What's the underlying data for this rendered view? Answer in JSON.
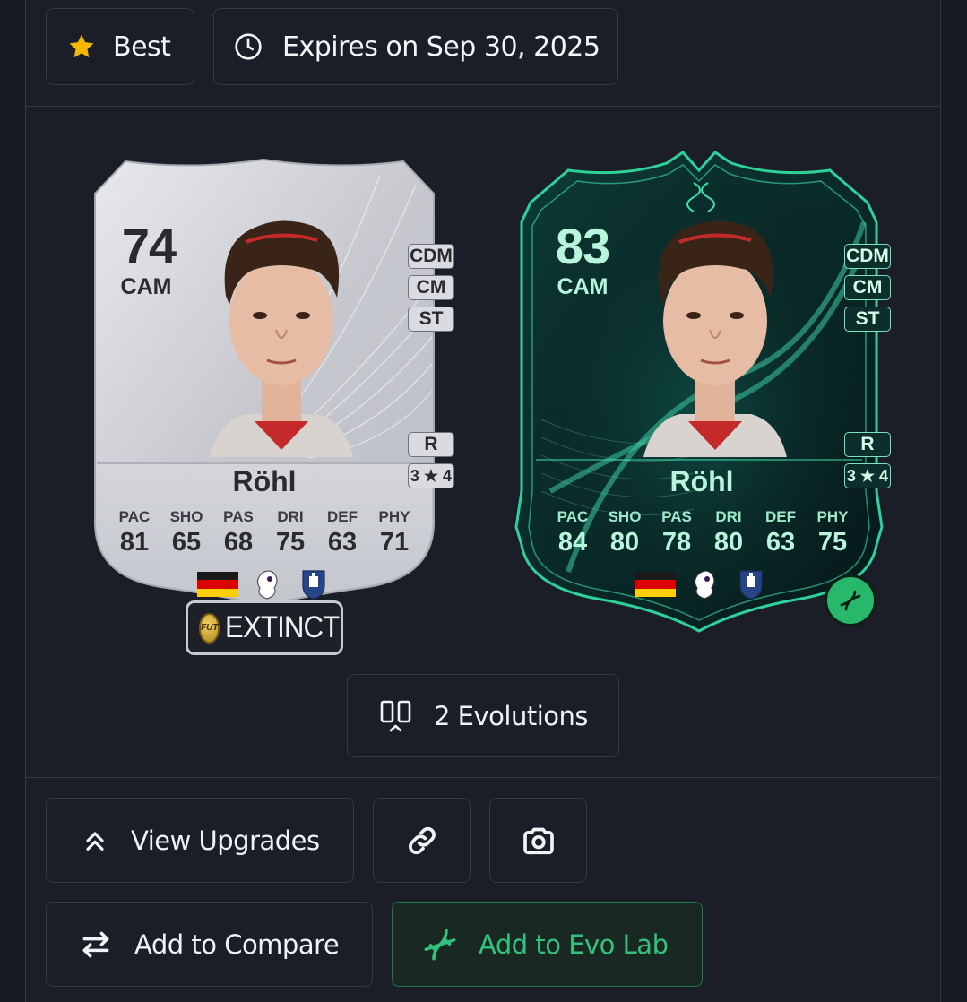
{
  "header": {
    "best_label": "Best",
    "expires_label": "Expires on Sep 30, 2025"
  },
  "cards": [
    {
      "rating": "74",
      "position": "CAM",
      "alt_positions": [
        "CDM",
        "CM",
        "ST"
      ],
      "foot": "R",
      "skills": "3 ★ 4",
      "name": "Röhl",
      "stats": [
        {
          "label": "PAC",
          "value": "81"
        },
        {
          "label": "SHO",
          "value": "65"
        },
        {
          "label": "PAS",
          "value": "68"
        },
        {
          "label": "DRI",
          "value": "75"
        },
        {
          "label": "DEF",
          "value": "63"
        },
        {
          "label": "PHY",
          "value": "71"
        }
      ],
      "badge": {
        "coin_text": "FUT",
        "label": "EXTINCT"
      }
    },
    {
      "rating": "83",
      "position": "CAM",
      "alt_positions": [
        "CDM",
        "CM",
        "ST"
      ],
      "foot": "R",
      "skills": "3 ★ 4",
      "name": "Röhl",
      "stats": [
        {
          "label": "PAC",
          "value": "84"
        },
        {
          "label": "SHO",
          "value": "80"
        },
        {
          "label": "PAS",
          "value": "78"
        },
        {
          "label": "DRI",
          "value": "80"
        },
        {
          "label": "DEF",
          "value": "63"
        },
        {
          "label": "PHY",
          "value": "75"
        }
      ]
    }
  ],
  "evolutions_label": "2 Evolutions",
  "actions": {
    "view_upgrades": "View Upgrades",
    "add_to_compare": "Add to Compare",
    "add_to_evo_lab": "Add to Evo Lab"
  },
  "icons": {
    "best": "star-icon",
    "expires": "clock-icon",
    "evolutions": "columns-icon",
    "upgrades": "double-chevron-up-icon",
    "link": "link-icon",
    "screenshot": "camera-icon",
    "compare": "swap-arrows-icon",
    "evo_lab": "dna-icon"
  },
  "colors": {
    "accent_green": "#33c27b",
    "star": "#f5b800",
    "card_green_text": "#b8f5dc"
  }
}
